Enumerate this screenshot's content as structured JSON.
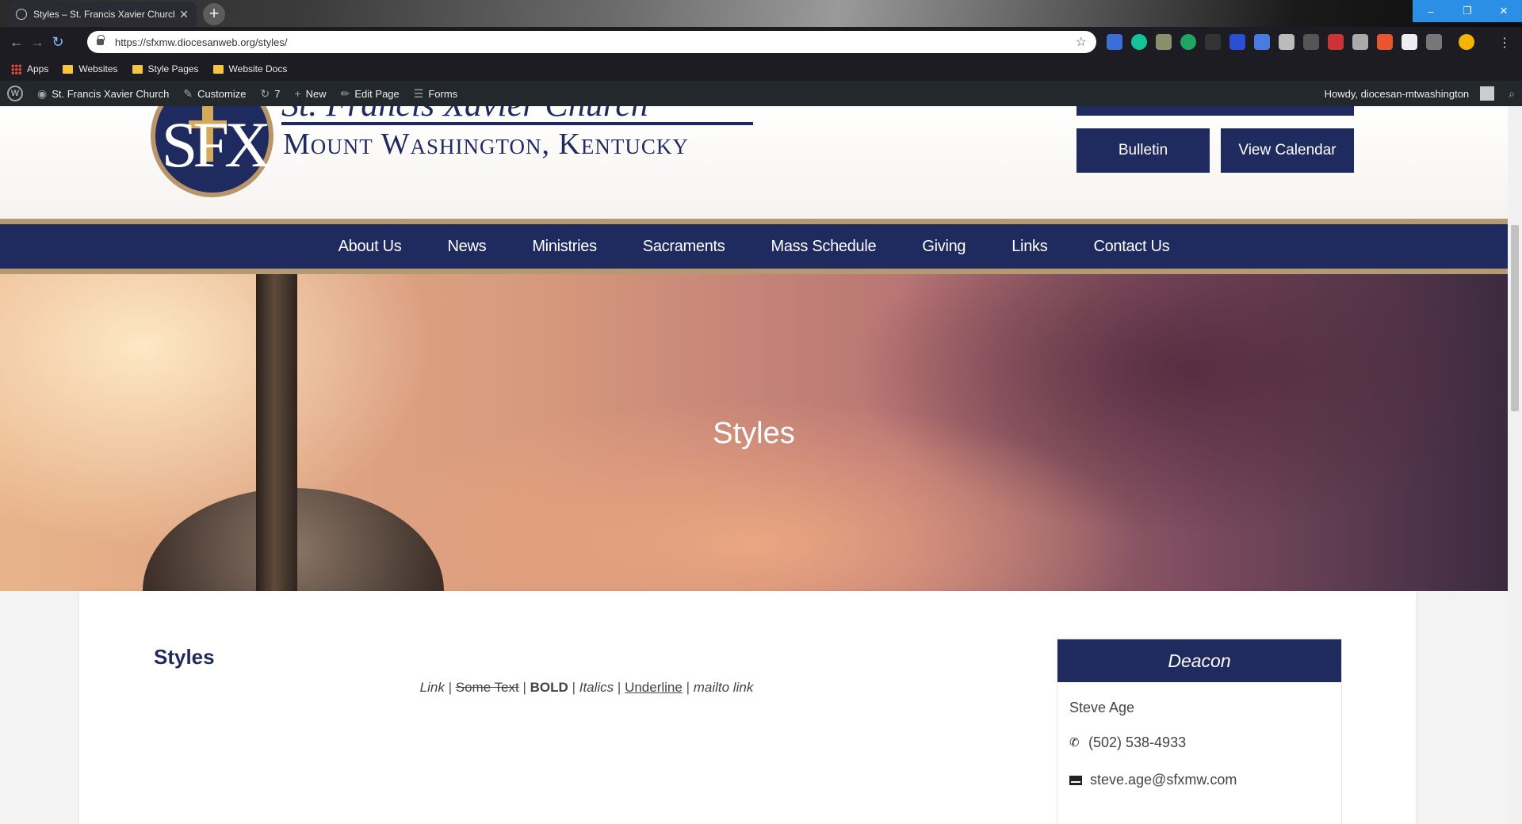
{
  "browser": {
    "tab_title": "Styles – St. Francis Xavier Church",
    "tab_close": "✕",
    "new_tab": "+",
    "url": "https://sfxmw.diocesanweb.org/styles/",
    "window_buttons": [
      "–",
      "❐",
      "✕"
    ],
    "bookmarks": [
      {
        "label": "Apps",
        "icon": "apps-icon"
      },
      {
        "label": "Websites",
        "icon": "folder-icon"
      },
      {
        "label": "Style Pages",
        "icon": "folder-icon"
      },
      {
        "label": "Website Docs",
        "icon": "folder-icon"
      }
    ]
  },
  "wp_admin_bar": {
    "site_name": "St. Francis Xavier Church",
    "customize": "Customize",
    "updates_count": "7",
    "new": "New",
    "edit_page": "Edit Page",
    "forms": "Forms",
    "howdy": "Howdy, diocesan-mtwashington"
  },
  "header": {
    "logo_monogram": "SFX",
    "logo_line1": "St. Francis Xavier Church",
    "logo_line2": "Mount Washington, Kentucky",
    "buttons": {
      "bulletin": "Bulletin",
      "calendar": "View Calendar"
    }
  },
  "nav": [
    "About Us",
    "News",
    "Ministries",
    "Sacraments",
    "Mass Schedule",
    "Giving",
    "Links",
    "Contact Us"
  ],
  "hero": {
    "title": "Styles"
  },
  "content": {
    "heading": "Styles",
    "style_examples": {
      "link": "Link",
      "strike": "Some Text",
      "bold": "BOLD",
      "italic": "Italics",
      "underline": "Underline",
      "mailto": "mailto link",
      "separator": "|"
    }
  },
  "sidebar": {
    "title": "Deacon",
    "name": "Steve Age",
    "phone": "(502) 538-4933",
    "email": "steve.age@sfxmw.com"
  },
  "colors": {
    "brand_navy": "#1f2b5e",
    "brand_gold": "#b39a72",
    "wp_bar": "#23282d"
  }
}
